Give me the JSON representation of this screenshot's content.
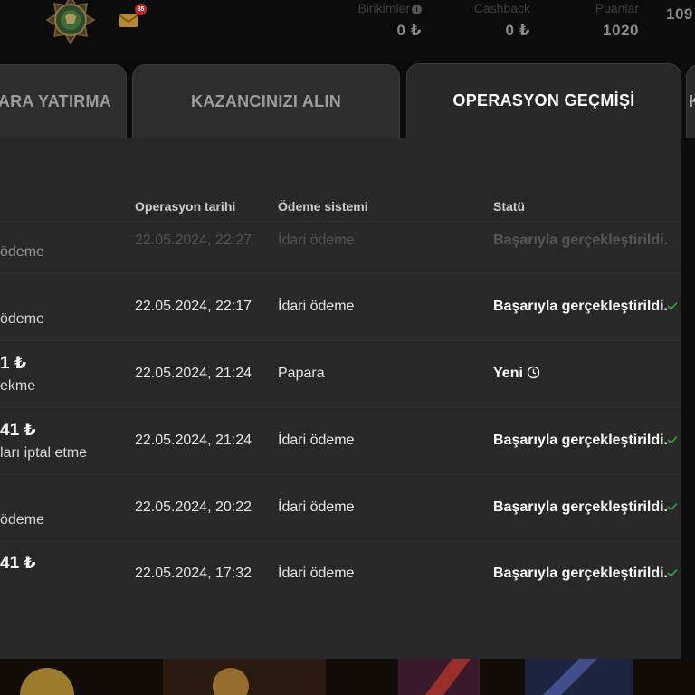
{
  "header": {
    "mail_badge": "35",
    "stats": [
      {
        "label": "Birikimler",
        "value": "0 ₺",
        "info": "i"
      },
      {
        "label": "Cashback",
        "value": "0 ₺"
      },
      {
        "label": "Puanlar",
        "value": "1020"
      },
      {
        "label": "",
        "value": "109"
      }
    ]
  },
  "tabs": [
    {
      "label": "PARA YATIRMA"
    },
    {
      "label": "KAZANCINIZI ALIN"
    },
    {
      "label": "OPERASYON GEÇMİŞİ",
      "active": true
    },
    {
      "label": "K"
    }
  ],
  "table": {
    "columns": [
      "Operasyon tarihi",
      "Ödeme sistemi",
      "Statü"
    ],
    "rows": [
      {
        "amount": "",
        "type": "ödeme",
        "date": "22.05.2024, 22:27",
        "system": "İdari ödeme",
        "status": "Başarıyla gerçekleştirildi.",
        "status_icon": "check",
        "faded": true
      },
      {
        "amount": "",
        "type": "ödeme",
        "date": "22.05.2024, 22:17",
        "system": "İdari ödeme",
        "status": "Başarıyla gerçekleştirildi.",
        "status_icon": "check"
      },
      {
        "amount": "1 ₺",
        "type": "ekme",
        "date": "22.05.2024, 21:24",
        "system": "Papara",
        "status": "Yeni",
        "status_icon": "clock"
      },
      {
        "amount": "41 ₺",
        "type": "ları iptal etme",
        "date": "22.05.2024, 21:24",
        "system": "İdari ödeme",
        "status": "Başarıyla gerçekleştirildi.",
        "status_icon": "check"
      },
      {
        "amount": "",
        "type": "ödeme",
        "date": "22.05.2024, 20:22",
        "system": "İdari ödeme",
        "status": "Başarıyla gerçekleştirildi.",
        "status_icon": "check"
      },
      {
        "amount": "41 ₺",
        "type": "",
        "date": "22.05.2024, 17:32",
        "system": "İdari ödeme",
        "status": "Başarıyla gerçekleştirildi.",
        "status_icon": "check"
      }
    ]
  },
  "colors": {
    "success_check": "#3aa14b",
    "panel_bg": "#282828",
    "page_bg": "#0a0a0a"
  },
  "icons": {
    "emblem": "compass-emblem-icon",
    "mail": "mail-icon",
    "info": "info-icon",
    "success": "check-icon",
    "pending": "clock-icon"
  }
}
